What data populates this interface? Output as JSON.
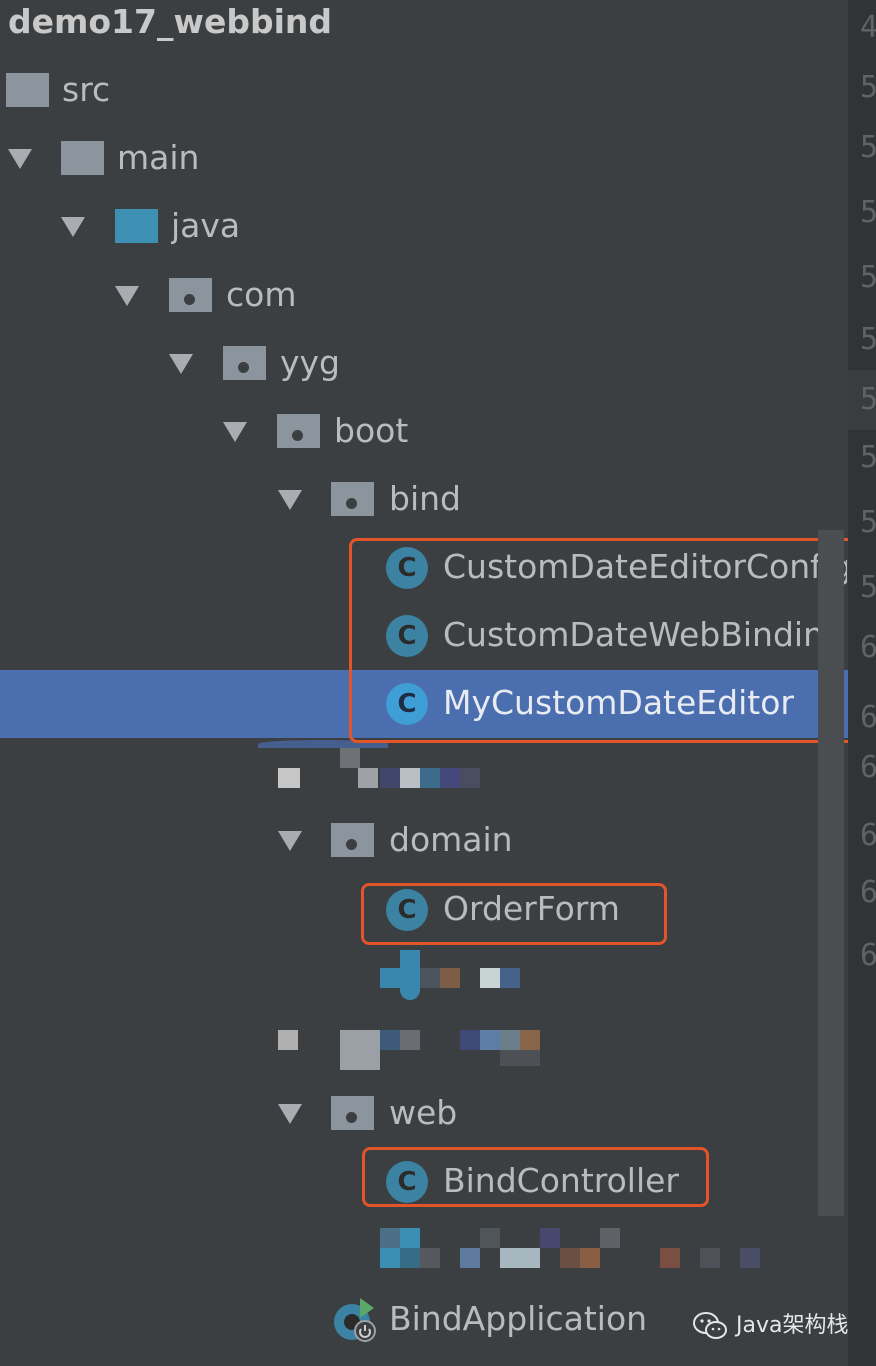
{
  "project": {
    "title": "demo17_webbind"
  },
  "tree": {
    "src": "src",
    "main": "main",
    "java": "java",
    "com": "com",
    "yyg": "yyg",
    "boot": "boot",
    "bind": "bind",
    "bind_classes": [
      "CustomDateEditorConfig",
      "CustomDateWebBinding",
      "MyCustomDateEditor"
    ],
    "domain": "domain",
    "domain_class": "OrderForm",
    "web": "web",
    "web_class": "BindController",
    "app_class": "BindApplication",
    "class_icon_letter": "C"
  },
  "gutter": {
    "line_digits": [
      "4",
      "5",
      "5",
      "5",
      "5",
      "5",
      "5",
      "5",
      "5",
      "5",
      "6",
      "6",
      "6",
      "6",
      "6",
      "6"
    ]
  },
  "watermark": {
    "text": "Java架构栈"
  },
  "colors": {
    "background": "#3c3f41",
    "selection": "#4b6eaf",
    "highlight_box": "#e2542a",
    "class_icon": "#3c83a3"
  }
}
